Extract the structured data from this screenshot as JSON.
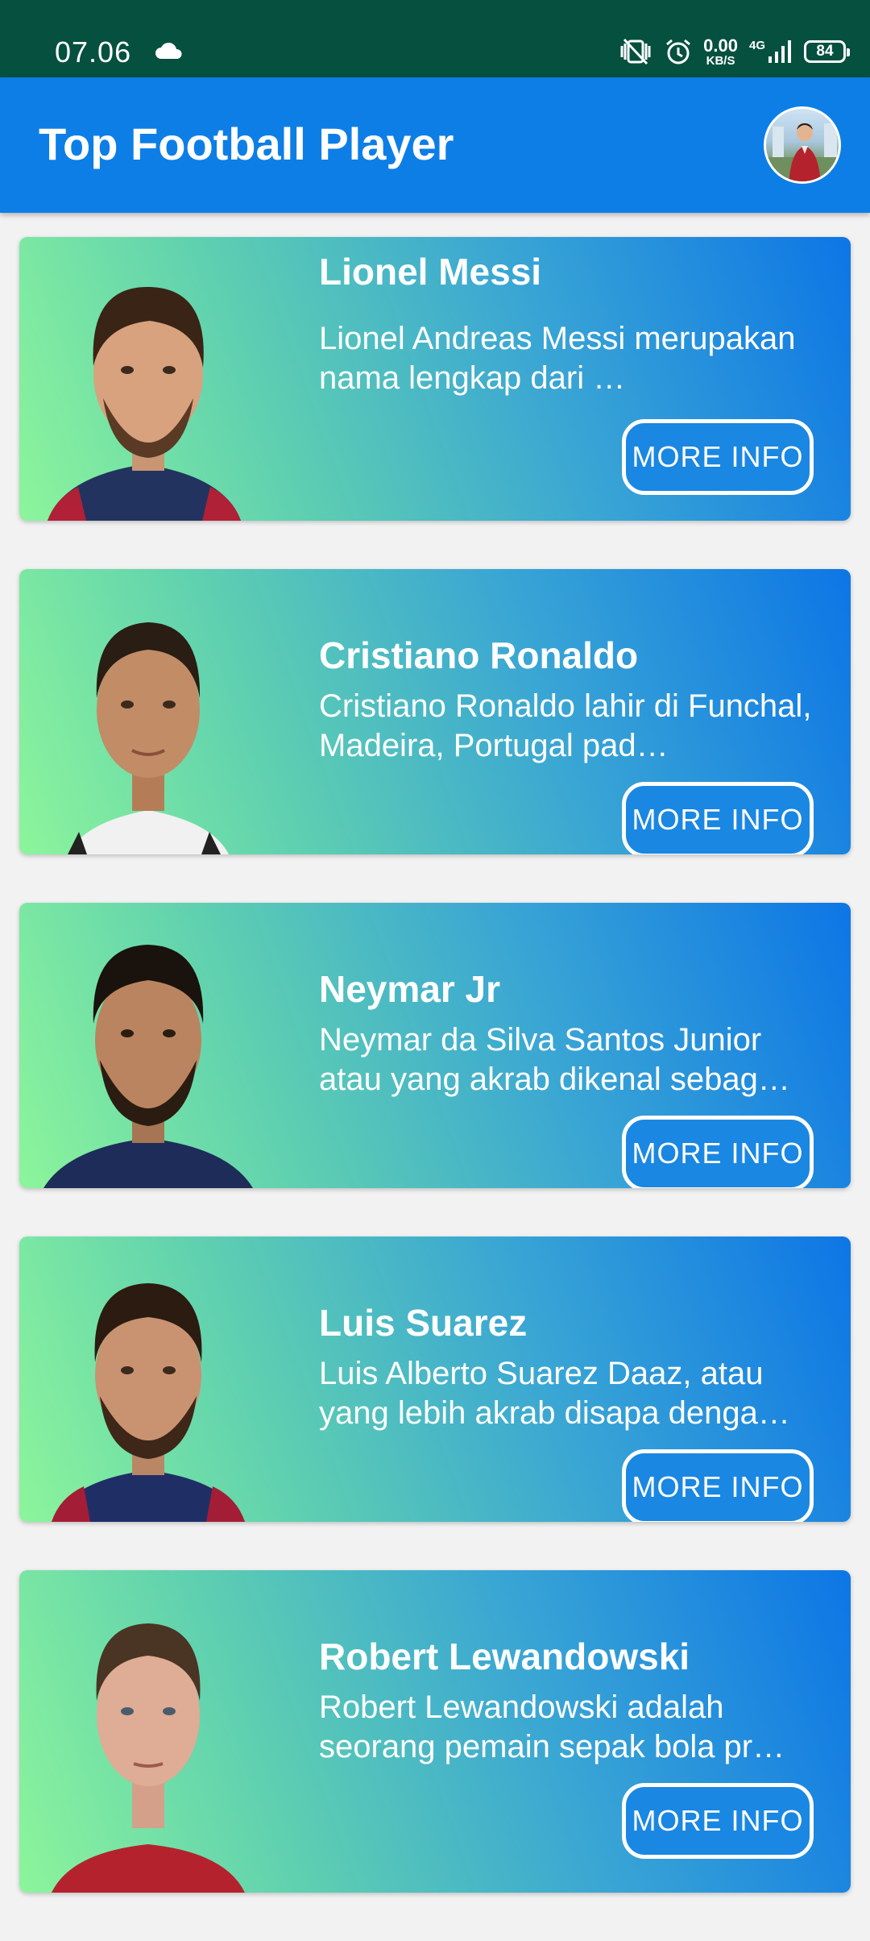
{
  "status_bar": {
    "time": "07.06",
    "speed_value": "0.00",
    "speed_unit": "KB/S",
    "network": "4G",
    "battery": "84"
  },
  "app_bar": {
    "title": "Top Football Player",
    "avatar_icon": "profile-avatar"
  },
  "players": [
    {
      "name": "Lionel Messi",
      "description": "Lionel Andreas Messi merupakan nama lengkap dari …",
      "button_label": "MORE INFO"
    },
    {
      "name": "Cristiano Ronaldo",
      "description": "Cristiano Ronaldo lahir di Funchal, Madeira, Portugal pad…",
      "button_label": "MORE INFO"
    },
    {
      "name": "Neymar Jr",
      "description": "Neymar da Silva Santos Junior atau yang akrab dikenal sebag…",
      "button_label": "MORE INFO"
    },
    {
      "name": "Luis Suarez",
      "description": "Luis Alberto Suarez Daaz, atau yang lebih akrab disapa denga…",
      "button_label": "MORE INFO"
    },
    {
      "name": "Robert Lewandowski",
      "description": "Robert Lewandowski adalah seorang pemain sepak bola pr…",
      "button_label": "MORE INFO"
    }
  ],
  "colors": {
    "status_bar": "#05503f",
    "app_bar": "#0d7ee6",
    "card_gradient_start": "#8cf59b",
    "card_gradient_end": "#0d76e6",
    "button_bg": "#1a87e2"
  }
}
